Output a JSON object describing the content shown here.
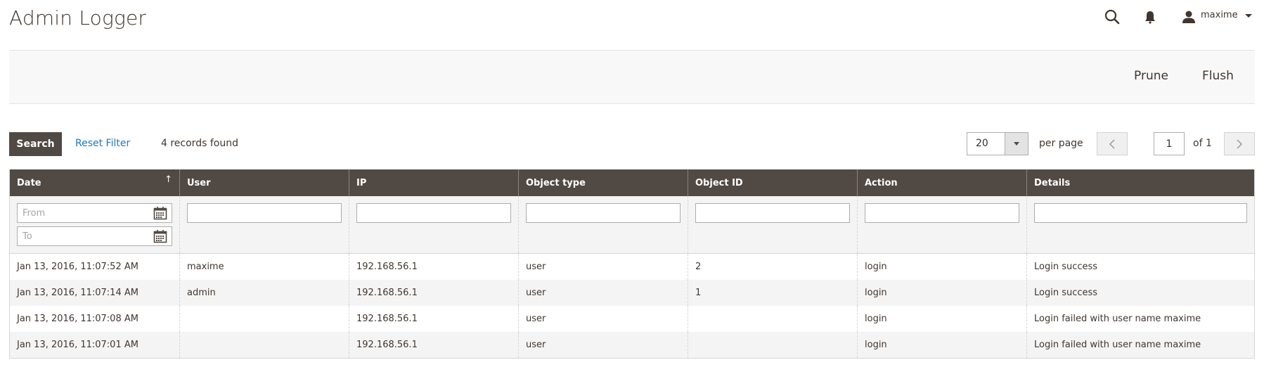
{
  "header": {
    "title": "Admin Logger",
    "icons": {
      "search": "search-icon",
      "notifications": "bell-icon",
      "user": "user-icon"
    },
    "user_name": "maxime"
  },
  "actions": {
    "prune_label": "Prune",
    "flush_label": "Flush"
  },
  "toolbar": {
    "search_label": "Search",
    "reset_label": "Reset Filter",
    "records_found": "4 records found",
    "per_page_value": "20",
    "per_page_label": "per page",
    "current_page": "1",
    "page_total": "of 1"
  },
  "grid": {
    "columns": [
      {
        "label": "Date",
        "sorted": "ascending",
        "sort_glyph": "↑"
      },
      {
        "label": "User"
      },
      {
        "label": "IP"
      },
      {
        "label": "Object type"
      },
      {
        "label": "Object ID"
      },
      {
        "label": "Action"
      },
      {
        "label": "Details"
      }
    ],
    "filters": {
      "date_from_placeholder": "From",
      "date_to_placeholder": "To",
      "user": "",
      "ip": "",
      "object_type": "",
      "object_id": "",
      "action": "",
      "details": ""
    },
    "rows": [
      {
        "date": "Jan 13, 2016, 11:07:52 AM",
        "user": "maxime",
        "ip": "192.168.56.1",
        "object_type": "user",
        "object_id": "2",
        "action": "login",
        "details": "Login success"
      },
      {
        "date": "Jan 13, 2016, 11:07:14 AM",
        "user": "admin",
        "ip": "192.168.56.1",
        "object_type": "user",
        "object_id": "1",
        "action": "login",
        "details": "Login success"
      },
      {
        "date": "Jan 13, 2016, 11:07:08 AM",
        "user": "",
        "ip": "192.168.56.1",
        "object_type": "user",
        "object_id": "",
        "action": "login",
        "details": "Login failed with user name maxime"
      },
      {
        "date": "Jan 13, 2016, 11:07:01 AM",
        "user": "",
        "ip": "192.168.56.1",
        "object_type": "user",
        "object_id": "",
        "action": "login",
        "details": "Login failed with user name maxime"
      }
    ]
  },
  "colors": {
    "header_bg": "#514943",
    "link": "#1979c3",
    "text": "#41362f"
  }
}
